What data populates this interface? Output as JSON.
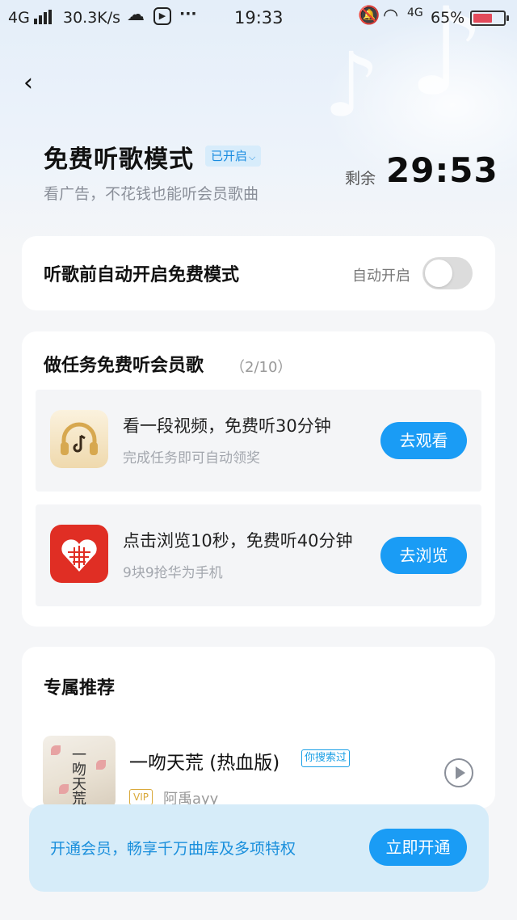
{
  "status_bar": {
    "network": "4G",
    "speed": "30.3K/s",
    "time": "19:33",
    "network_right": "4G",
    "battery": "65%",
    "battery_level": 0.65,
    "battery_color": "#e34a5a"
  },
  "header": {
    "title": "免费听歌模式",
    "status_chip": "已开启",
    "subtitle": "看广告，不花钱也能听会员歌曲",
    "remain_label": "剩余",
    "remain_time": "29:53"
  },
  "auto_mode": {
    "label": "听歌前自动开启免费模式",
    "toggle_label": "自动开启",
    "toggle_on": false
  },
  "tasks": {
    "heading": "做任务免费听会员歌",
    "progress": "（2/10）",
    "items": [
      {
        "icon": "music-headphones-app-icon",
        "title": "看一段视频，免费听30分钟",
        "subtitle": "完成任务即可自动领奖",
        "button": "去观看"
      },
      {
        "icon": "pinduoduo-app-icon",
        "title": "点击浏览10秒，免费听40分钟",
        "subtitle": "9块9抢华为手机",
        "button": "去浏览"
      }
    ]
  },
  "recommend": {
    "heading": "专属推荐",
    "songs": [
      {
        "title": "一吻天荒 (热血版)",
        "tag": "你搜索过",
        "badge": "VIP",
        "artist": "阿禹ayy",
        "cover_text": "一吻天荒"
      }
    ]
  },
  "membership": {
    "text": "开通会员，畅享千万曲库及多项特权",
    "button": "立即开通"
  },
  "colors": {
    "accent": "#1a9cf5",
    "accent_text": "#1a8fdc",
    "chip_bg": "#d7ecfb",
    "member_bar_bg": "#d6ecf9"
  }
}
